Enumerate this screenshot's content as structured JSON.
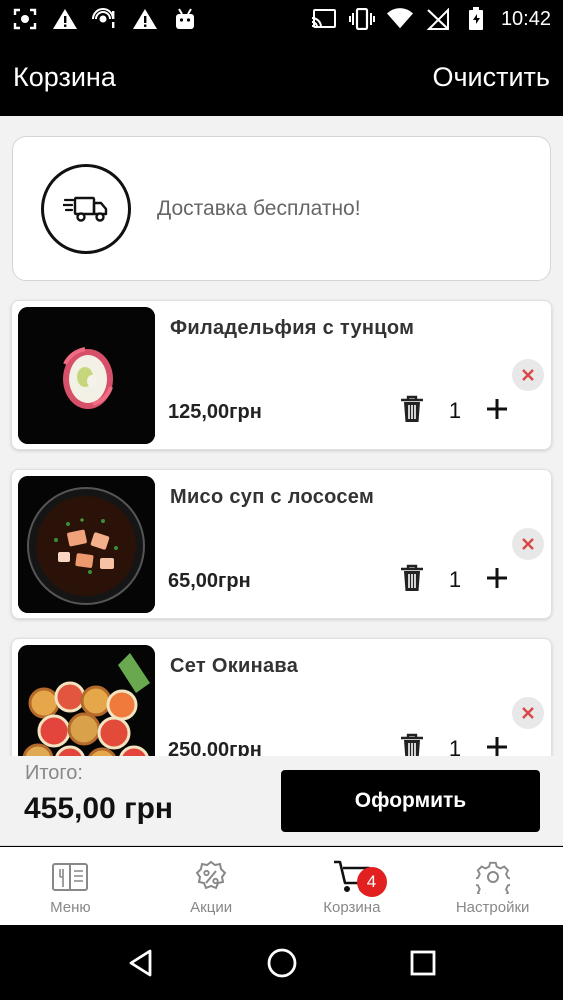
{
  "status_bar": {
    "time": "10:42",
    "left_icons": [
      "screenshot-icon",
      "warning-icon",
      "hotspot-icon",
      "warning-icon",
      "android-icon"
    ],
    "right_icons": [
      "cast-icon",
      "vibrate-icon",
      "wifi-icon",
      "no-signal-icon",
      "battery-icon"
    ]
  },
  "header": {
    "title": "Корзина",
    "clear_label": "Очистить"
  },
  "delivery": {
    "icon": "delivery-truck-icon",
    "text": "Доставка бесплатно!"
  },
  "cart": {
    "items": [
      {
        "name": "Филадельфия с тунцом",
        "price": "125,00грн",
        "qty": "1"
      },
      {
        "name": "Мисо суп с лососем",
        "price": "65,00грн",
        "qty": "1"
      },
      {
        "name": "Сет Окинава",
        "price": "250,00грн",
        "qty": "1"
      }
    ]
  },
  "summary": {
    "total_label": "Итого:",
    "total_value": "455,00 грн",
    "checkout_label": "Оформить"
  },
  "nav": {
    "items": [
      {
        "label": "Меню",
        "icon": "menu-book-icon"
      },
      {
        "label": "Акции",
        "icon": "discount-icon"
      },
      {
        "label": "Корзина",
        "icon": "cart-icon"
      },
      {
        "label": "Настройки",
        "icon": "settings-gear-icon"
      }
    ],
    "cart_badge": "4"
  },
  "colors": {
    "accent": "#000000",
    "badge": "#e32020",
    "remove_x": "#d84848",
    "background": "#f2f2f2"
  }
}
